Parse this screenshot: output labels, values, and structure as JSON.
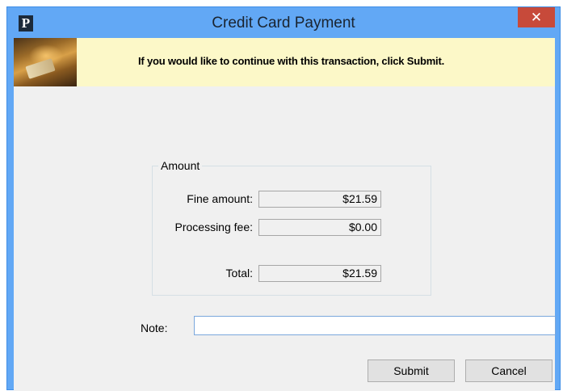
{
  "window": {
    "title": "Credit Card Payment",
    "app_icon_letter": "P",
    "close_glyph": "✕"
  },
  "banner": {
    "message": "If you would like to continue with this transaction, click Submit."
  },
  "amount": {
    "group_label": "Amount",
    "rows": [
      {
        "label": "Fine amount:",
        "value": "$21.59"
      },
      {
        "label": "Processing fee:",
        "value": "$0.00"
      },
      {
        "label": "Total:",
        "value": "$21.59"
      }
    ]
  },
  "note": {
    "label": "Note:",
    "value": ""
  },
  "buttons": {
    "submit": "Submit",
    "cancel": "Cancel"
  },
  "colors": {
    "titlebar": "#62a8f5",
    "close": "#c74a3a",
    "banner": "#fcf8c8",
    "dialog_bg": "#f0f0f0"
  },
  "icons": {
    "app": "app-p-icon",
    "close": "close-icon",
    "banner": "credit-card-image"
  }
}
